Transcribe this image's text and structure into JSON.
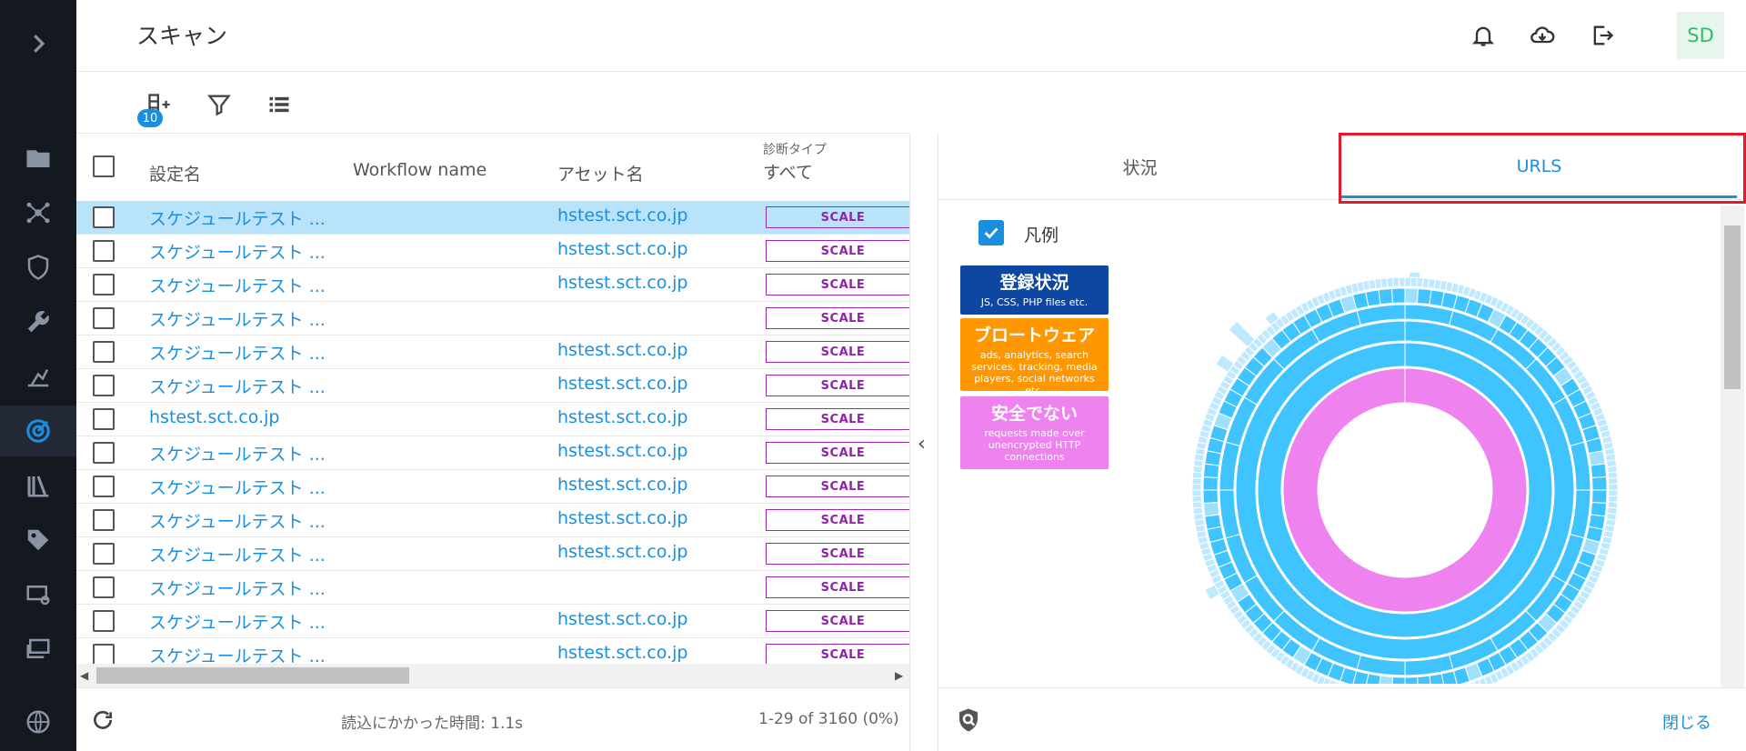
{
  "app": {
    "page_title": "スキャン",
    "user_initials": "SD"
  },
  "toolbar": {
    "queue_badge": "10"
  },
  "table": {
    "columns": {
      "name": "設定名",
      "workflow": "Workflow name",
      "asset": "アセット名",
      "type_label": "診断タイプ",
      "type_value": "すべて"
    },
    "rows": [
      {
        "name": "スケジュールテスト ...",
        "asset": "hstest.sct.co.jp",
        "type": "SCALE",
        "selected": true
      },
      {
        "name": "スケジュールテスト ...",
        "asset": "hstest.sct.co.jp",
        "type": "SCALE"
      },
      {
        "name": "スケジュールテスト ...",
        "asset": "hstest.sct.co.jp",
        "type": "SCALE"
      },
      {
        "name": "スケジュールテスト ...",
        "asset": "",
        "type": "SCALE"
      },
      {
        "name": "スケジュールテスト ...",
        "asset": "hstest.sct.co.jp",
        "type": "SCALE"
      },
      {
        "name": "スケジュールテスト ...",
        "asset": "hstest.sct.co.jp",
        "type": "SCALE"
      },
      {
        "name": "hstest.sct.co.jp",
        "asset": "hstest.sct.co.jp",
        "type": "SCALE"
      },
      {
        "name": "スケジュールテスト ...",
        "asset": "hstest.sct.co.jp",
        "type": "SCALE"
      },
      {
        "name": "スケジュールテスト ...",
        "asset": "hstest.sct.co.jp",
        "type": "SCALE"
      },
      {
        "name": "スケジュールテスト ...",
        "asset": "hstest.sct.co.jp",
        "type": "SCALE"
      },
      {
        "name": "スケジュールテスト ...",
        "asset": "hstest.sct.co.jp",
        "type": "SCALE"
      },
      {
        "name": "スケジュールテスト ...",
        "asset": "",
        "type": "SCALE"
      },
      {
        "name": "スケジュールテスト ...",
        "asset": "hstest.sct.co.jp",
        "type": "SCALE"
      },
      {
        "name": "スケジュールテスト ...",
        "asset": "hstest.sct.co.jp",
        "type": "SCALE"
      }
    ]
  },
  "footer": {
    "load_time": "読込にかかった時間: 1.1s",
    "pagination": "1-29 of 3160 (0%)"
  },
  "panel": {
    "tab_status": "状況",
    "tab_urls": "URLS",
    "legend_label": "凡例",
    "close_label": "閉じる",
    "legend": [
      {
        "title": "登録状況",
        "desc": "JS, CSS, PHP files etc.",
        "color": "#0d47a1"
      },
      {
        "title": "ブロートウェア",
        "desc": "ads, analytics, search services, tracking, media players, social networks etc.",
        "color": "#ff9800"
      },
      {
        "title": "安全でない",
        "desc": "requests made over unencrypted HTTP connections",
        "color": "#ee82ee"
      }
    ]
  },
  "colors": {
    "accent": "#1a8fe0",
    "sidebar": "#14181f",
    "highlight": "#e21b2a",
    "sunburst_blue": "#40c4ff",
    "sunburst_pink": "#ee82ee"
  }
}
